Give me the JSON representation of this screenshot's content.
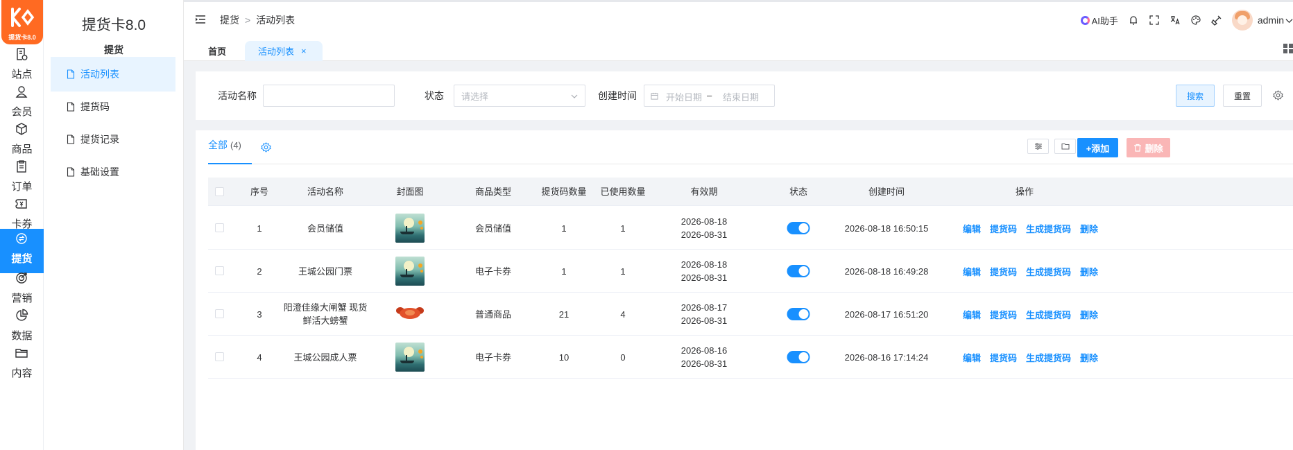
{
  "app": {
    "logo_text": "提货卡8.0",
    "title": "提货卡8.0"
  },
  "rail": [
    {
      "label": "站点",
      "icon": "site-icon"
    },
    {
      "label": "会员",
      "icon": "user-icon"
    },
    {
      "label": "商品",
      "icon": "box-icon"
    },
    {
      "label": "订单",
      "icon": "order-icon"
    },
    {
      "label": "卡券",
      "icon": "coupon-icon"
    },
    {
      "label": "提货",
      "icon": "pickup-icon",
      "active": true
    },
    {
      "label": "营销",
      "icon": "target-icon"
    },
    {
      "label": "数据",
      "icon": "pie-icon"
    },
    {
      "label": "内容",
      "icon": "folder-icon"
    }
  ],
  "submenu": {
    "group_title": "提货",
    "items": [
      {
        "label": "活动列表",
        "active": true
      },
      {
        "label": "提货码"
      },
      {
        "label": "提货记录"
      },
      {
        "label": "基础设置"
      }
    ]
  },
  "header": {
    "breadcrumb": [
      "提货",
      "活动列表"
    ],
    "breadcrumb_sep": ">",
    "ai_label": "AI助手",
    "user_name": "admin"
  },
  "tabs": {
    "home": "首页",
    "current": "活动列表",
    "close": "×"
  },
  "search": {
    "name_label": "活动名称",
    "name_value": "",
    "status_label": "状态",
    "status_placeholder": "请选择",
    "time_label": "创建时间",
    "start_placeholder": "开始日期",
    "range_sep": "–",
    "end_placeholder": "结束日期",
    "search_btn": "搜索",
    "reset_btn": "重置"
  },
  "table": {
    "tab_all": "全部",
    "tab_count": "(4)",
    "add_btn": "+添加",
    "delete_btn": "删除",
    "columns": [
      "序号",
      "活动名称",
      "封面图",
      "商品类型",
      "提货码数量",
      "已使用数量",
      "有效期",
      "状态",
      "创建时间",
      "操作"
    ],
    "rows": [
      {
        "index": "1",
        "name": "会员储值",
        "name2": "",
        "cover": "lake",
        "type": "会员储值",
        "codes": "1",
        "used": "1",
        "valid_from": "2026-08-18",
        "valid_to": "2026-08-31",
        "enabled": true,
        "created": "2026-08-18 16:50:15"
      },
      {
        "index": "2",
        "name": "王城公园门票",
        "name2": "",
        "cover": "lake",
        "type": "电子卡券",
        "codes": "1",
        "used": "1",
        "valid_from": "2026-08-18",
        "valid_to": "2026-08-31",
        "enabled": true,
        "created": "2026-08-18 16:49:28"
      },
      {
        "index": "3",
        "name": "阳澄佳缘大闸蟹 现货",
        "name2": "鲜活大螃蟹",
        "cover": "crab",
        "type": "普通商品",
        "codes": "21",
        "used": "4",
        "valid_from": "2026-08-17",
        "valid_to": "2026-08-31",
        "enabled": true,
        "created": "2026-08-17 16:51:20"
      },
      {
        "index": "4",
        "name": "王城公园成人票",
        "name2": "",
        "cover": "lake",
        "type": "电子卡券",
        "codes": "10",
        "used": "0",
        "valid_from": "2026-08-16",
        "valid_to": "2026-08-31",
        "enabled": true,
        "created": "2026-08-16 17:14:24"
      }
    ],
    "actions": [
      "编辑",
      "提货码",
      "生成提货码",
      "删除"
    ]
  },
  "colors": {
    "primary": "#1890ff",
    "logo": "#ff6a22",
    "danger_light": "#fab6b6"
  }
}
